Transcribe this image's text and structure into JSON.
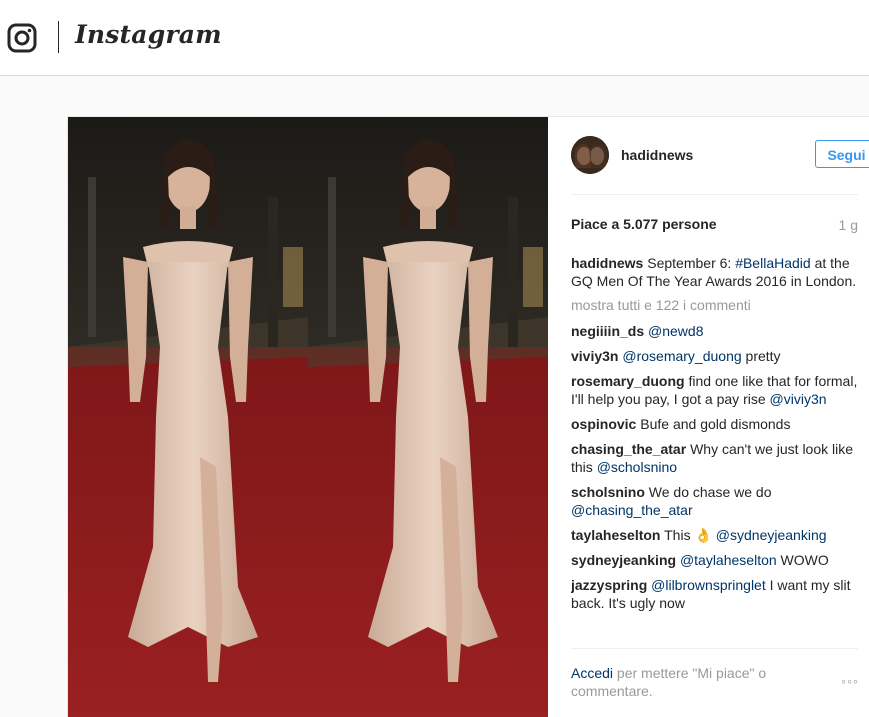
{
  "header": {
    "logo_icon": "instagram-camera-icon",
    "wordmark": "Instagram"
  },
  "post": {
    "username": "hadidnews",
    "follow_label": "Segui",
    "likes_text": "Piace a 5.077 persone",
    "age": "1 g",
    "caption": {
      "user": "hadidnews",
      "text_before": "September 6: ",
      "hashtag": "#BellaHadid",
      "text_after": " at the GQ Men Of The Year Awards 2016 in London."
    },
    "view_all_comments": "mostra tutti e 122 i commenti",
    "comments": [
      {
        "user": "negiiiin_ds",
        "pre": "",
        "tag": "@newd8",
        "post": ""
      },
      {
        "user": "viviy3n",
        "pre": "",
        "tag": "@rosemary_duong",
        "post": " pretty"
      },
      {
        "user": "rosemary_duong",
        "pre": "find one like that for formal, I'll help you pay, I got a pay rise ",
        "tag": "@viviy3n",
        "post": ""
      },
      {
        "user": "ospinovic",
        "pre": "Bufe and gold dismonds",
        "tag": "",
        "post": ""
      },
      {
        "user": "chasing_the_atar",
        "pre": "Why can't we just look like this ",
        "tag": "@scholsnino",
        "post": ""
      },
      {
        "user": "scholsnino",
        "pre": "We do chase we do ",
        "tag": "@chasing_the_atar",
        "post": ""
      },
      {
        "user": "taylaheselton",
        "pre": "This 👌 ",
        "tag": "@sydneyjeanking",
        "post": ""
      },
      {
        "user": "sydneyjeanking",
        "pre": "",
        "tag": "@taylaheselton",
        "post": " WOWO"
      },
      {
        "user": "jazzyspring",
        "pre": "",
        "tag": "@lilbrownspringlet",
        "post": " I want my slit back. It's ugly now"
      }
    ],
    "login_link": "Accedi",
    "login_text": " per mettere \"Mi piace\" o commentare.",
    "more_icon": "more-options-icon",
    "more_glyph": "◦◦◦"
  },
  "colors": {
    "link": "#003569",
    "accent": "#3897f0",
    "muted": "#999999",
    "carpet": "#8e1b1c"
  }
}
